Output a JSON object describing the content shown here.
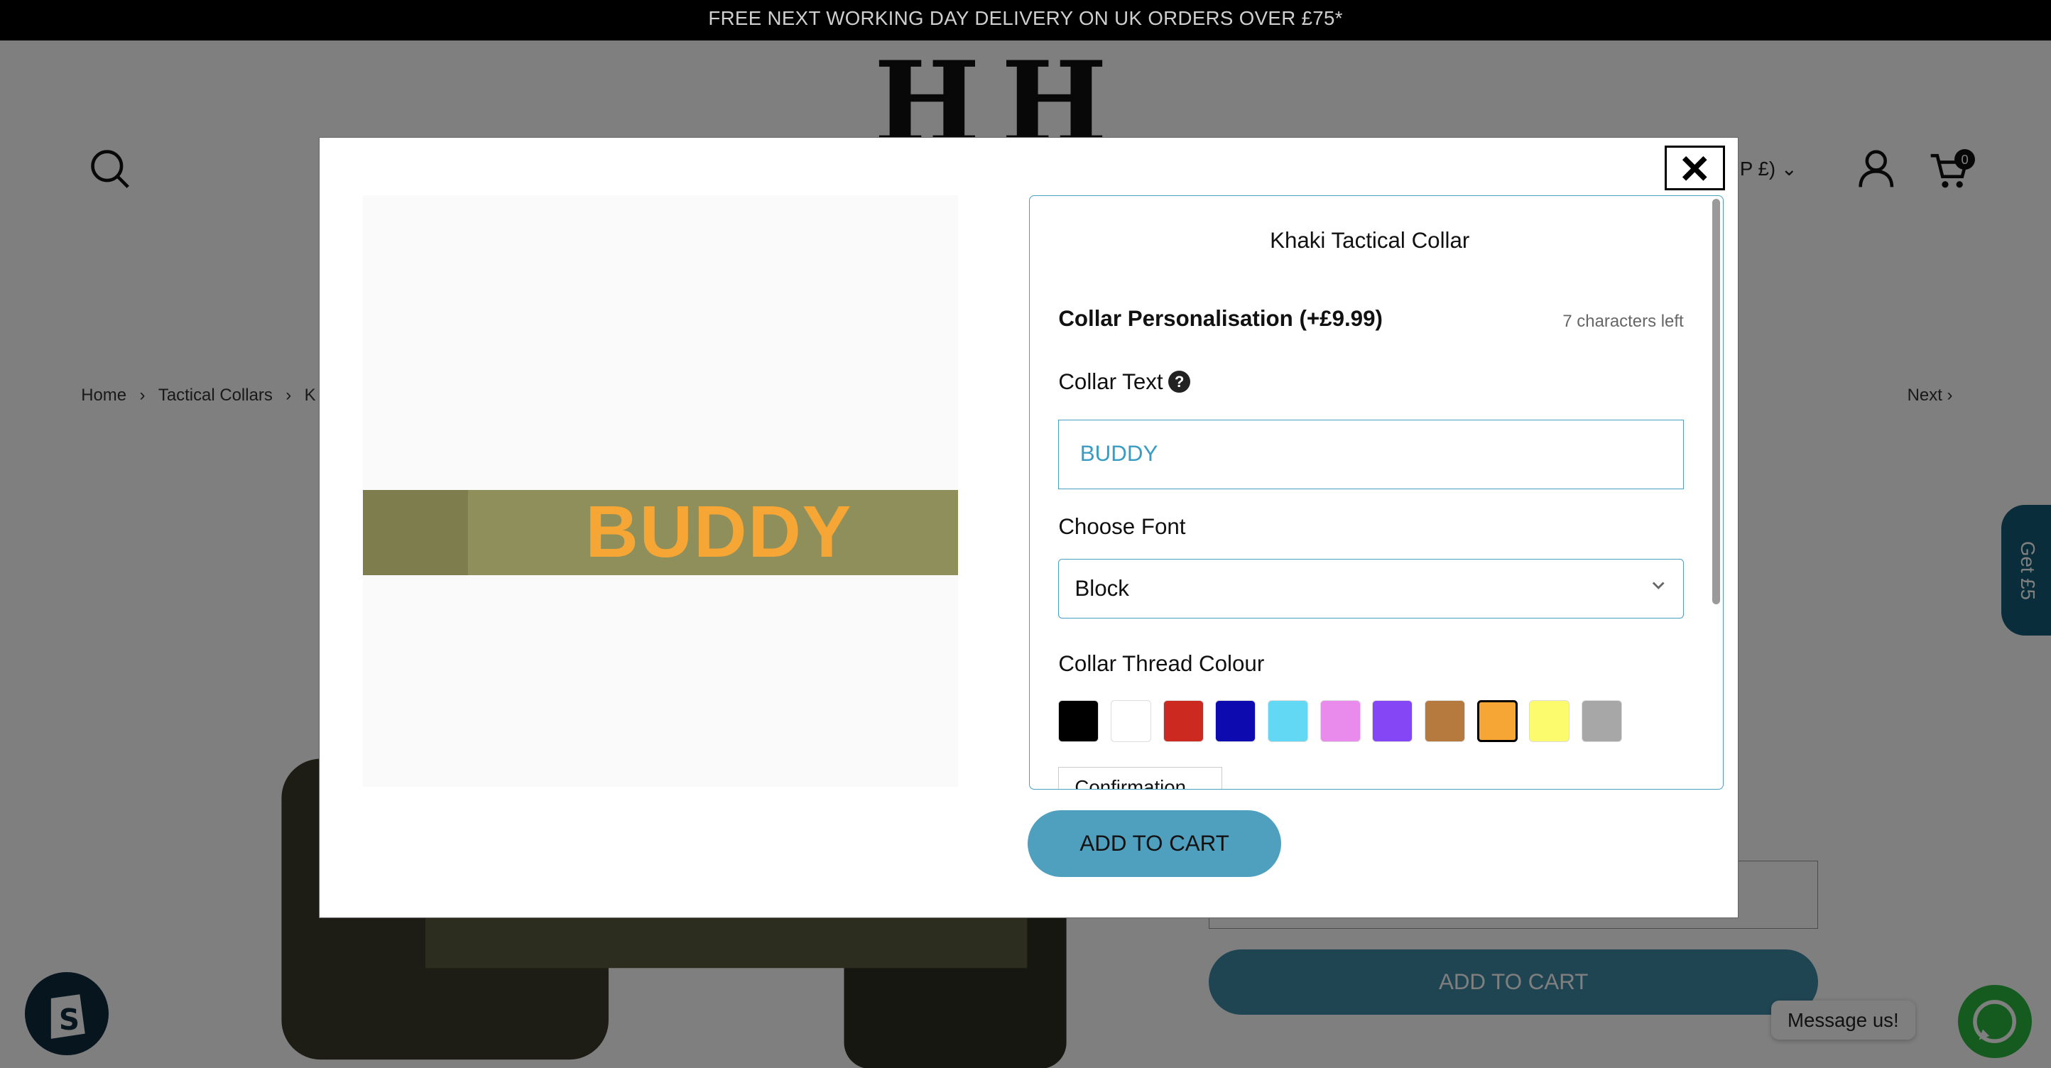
{
  "announcement": "FREE NEXT WORKING DAY DELIVERY ON UK ORDERS OVER £75*",
  "header": {
    "logo_text": "HH",
    "currency_fragment": "P £)",
    "cart_count": "0"
  },
  "breadcrumb": {
    "home": "Home",
    "category": "Tactical Collars",
    "current_fragment": "K",
    "next": "Next"
  },
  "background": {
    "add_to_cart": "ADD TO CART",
    "get5_tab": "Get £5",
    "message_bubble": "Message us!"
  },
  "modal": {
    "preview_text": "BUDDY",
    "preview_text_color": "#f5a634",
    "product_title": "Khaki Tactical Collar",
    "personalisation_label": "Collar Personalisation (+£9.99)",
    "chars_left": "7 characters left",
    "collar_text_label": "Collar Text",
    "collar_text_value": "BUDDY",
    "font_label": "Choose Font",
    "font_value": "Block",
    "thread_label": "Collar Thread Colour",
    "thread_colours": [
      "#000000",
      "#ffffff",
      "#cc2a20",
      "#0d0ab0",
      "#62d8f5",
      "#e98aed",
      "#8547f5",
      "#b67a3e",
      "#f5a634",
      "#fbfb6d",
      "#a7a7a7"
    ],
    "selected_colour_index": 8,
    "confirm_fragment": "Confirmation",
    "add_to_cart": "ADD TO CART"
  },
  "colors": {
    "accent": "#4f9fbf",
    "input_border": "#4aa0c3"
  }
}
